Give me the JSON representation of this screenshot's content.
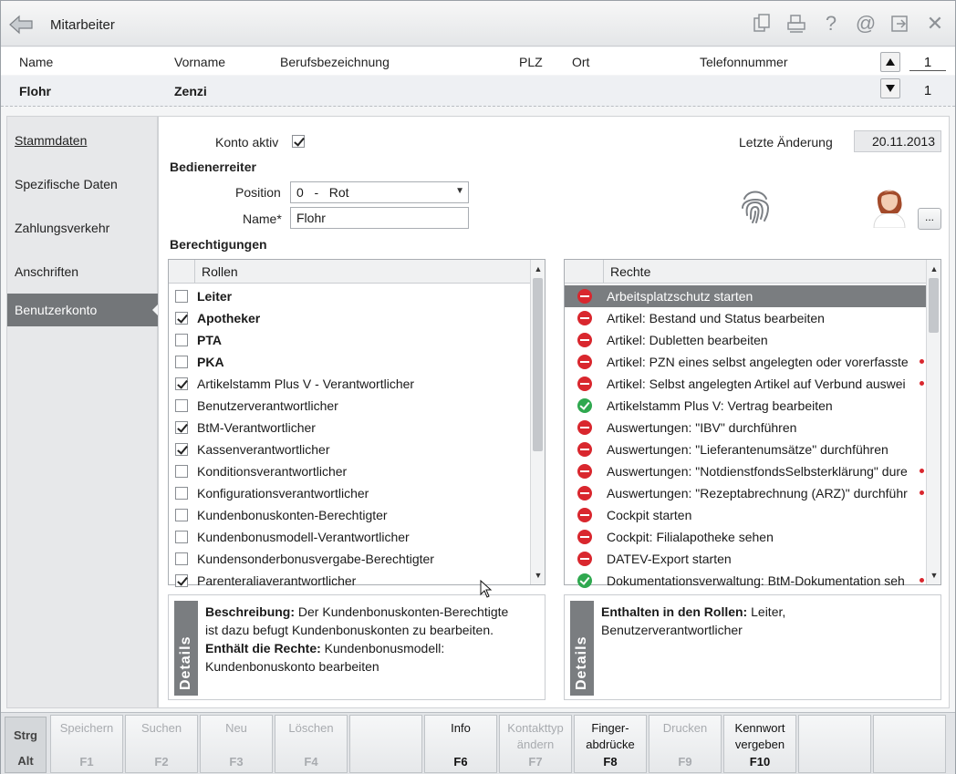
{
  "titlebar": {
    "title": "Mitarbeiter",
    "icons": [
      "back-icon",
      "copy-icon",
      "print-icon",
      "help-icon",
      "at-icon",
      "exit-icon",
      "close-icon"
    ]
  },
  "header": {
    "columns": {
      "name": "Name",
      "vorname": "Vorname",
      "beruf": "Berufsbezeichnung",
      "plz": "PLZ",
      "ort": "Ort",
      "telefon": "Telefonnummer"
    },
    "record": {
      "name": "Flohr",
      "vorname": "Zenzi"
    },
    "counter_top": "1",
    "counter_bottom": "1"
  },
  "nav": {
    "items": [
      {
        "label": "Stammdaten"
      },
      {
        "label": "Spezifische Daten"
      },
      {
        "label": "Zahlungsverkehr"
      },
      {
        "label": "Anschriften"
      },
      {
        "label": "Benutzerkonto"
      }
    ],
    "active_index": 4
  },
  "form": {
    "konto_aktiv_label": "Konto aktiv",
    "konto_aktiv": true,
    "letzte_aenderung_label": "Letzte Änderung",
    "letzte_aenderung": "20.11.2013",
    "bedienerreiter_label": "Bedienerreiter",
    "position_label": "Position",
    "position_value": "0   -   Rot",
    "name_label": "Name*",
    "name_value": "Flohr",
    "berechtigungen_label": "Berechtigungen",
    "dots_label": "..."
  },
  "roles": {
    "header": "Rollen",
    "items": [
      {
        "label": "Leiter",
        "checked": false,
        "bold": true
      },
      {
        "label": "Apotheker",
        "checked": true,
        "bold": true
      },
      {
        "label": "PTA",
        "checked": false,
        "bold": true
      },
      {
        "label": "PKA",
        "checked": false,
        "bold": true
      },
      {
        "label": "Artikelstamm Plus V - Verantwortlicher",
        "checked": true,
        "bold": false
      },
      {
        "label": "Benutzerverantwortlicher",
        "checked": false,
        "bold": false
      },
      {
        "label": "BtM-Verantwortlicher",
        "checked": true,
        "bold": false
      },
      {
        "label": "Kassenverantwortlicher",
        "checked": true,
        "bold": false
      },
      {
        "label": "Konditionsverantwortlicher",
        "checked": false,
        "bold": false
      },
      {
        "label": "Konfigurationsverantwortlicher",
        "checked": false,
        "bold": false
      },
      {
        "label": "Kundenbonuskonten-Berechtigter",
        "checked": false,
        "bold": false
      },
      {
        "label": "Kundenbonusmodell-Verantwortlicher",
        "checked": false,
        "bold": false
      },
      {
        "label": "Kundensonderbonusvergabe-Berechtigter",
        "checked": false,
        "bold": false
      },
      {
        "label": "Parenteraliaverantwortlicher",
        "checked": true,
        "bold": false
      }
    ]
  },
  "rights": {
    "header": "Rechte",
    "items": [
      {
        "label": "Arbeitsplatzschutz starten",
        "status": "deny",
        "selected": true
      },
      {
        "label": "Artikel: Bestand und Status bearbeiten",
        "status": "deny"
      },
      {
        "label": "Artikel: Dubletten bearbeiten",
        "status": "deny"
      },
      {
        "label": "Artikel: PZN eines selbst angelegten oder vorerfasste",
        "status": "deny",
        "truncated": true
      },
      {
        "label": "Artikel: Selbst angelegten Artikel auf Verbund auswei",
        "status": "deny",
        "truncated": true
      },
      {
        "label": "Artikelstamm Plus V: Vertrag bearbeiten",
        "status": "ok"
      },
      {
        "label": "Auswertungen: \"IBV\" durchführen",
        "status": "deny"
      },
      {
        "label": "Auswertungen: \"Lieferantenumsätze\" durchführen",
        "status": "deny"
      },
      {
        "label": "Auswertungen: \"NotdienstfondsSelbsterklärung\" dure",
        "status": "deny",
        "truncated": true
      },
      {
        "label": "Auswertungen: \"Rezeptabrechnung (ARZ)\" durchführ",
        "status": "deny",
        "truncated": true
      },
      {
        "label": "Cockpit starten",
        "status": "deny"
      },
      {
        "label": "Cockpit: Filialapotheke sehen",
        "status": "deny"
      },
      {
        "label": "DATEV-Export starten",
        "status": "deny"
      },
      {
        "label": "Dokumentationsverwaltung: BtM-Dokumentation seh",
        "status": "ok",
        "truncated": true
      }
    ]
  },
  "details_left": {
    "tab": "Details",
    "beschreibung_label": "Beschreibung:",
    "beschreibung_text_1": " Der Kundenbonuskonten-Berechtigte",
    "beschreibung_text_2": "ist dazu befugt Kundenbonuskonten zu bearbeiten.",
    "rechte_label": "Enthält die Rechte:",
    "rechte_text_1": " Kundenbonusmodell:",
    "rechte_text_2": "Kundenbonuskonto bearbeiten"
  },
  "details_right": {
    "tab": "Details",
    "rollen_label": "Enthalten in den Rollen:",
    "rollen_text_1": " Leiter,",
    "rollen_text_2": "Benutzerverantwortlicher"
  },
  "fkeys": {
    "mod_strg": "Strg",
    "mod_alt": "Alt",
    "keys": [
      {
        "label": "Speichern",
        "key": "F1",
        "enabled": false
      },
      {
        "label": "Suchen",
        "key": "F2",
        "enabled": false
      },
      {
        "label": "Neu",
        "key": "F3",
        "enabled": false
      },
      {
        "label": "Löschen",
        "key": "F4",
        "enabled": false
      },
      {
        "label": "",
        "key": "",
        "enabled": false
      },
      {
        "label": "Info",
        "key": "F6",
        "enabled": true
      },
      {
        "label": "Kontakttyp\nändern",
        "key": "F7",
        "enabled": false
      },
      {
        "label": "Finger-\nabdrücke",
        "key": "F8",
        "enabled": true
      },
      {
        "label": "Drucken",
        "key": "F9",
        "enabled": false
      },
      {
        "label": "Kennwort\nvergeben",
        "key": "F10",
        "enabled": true
      },
      {
        "label": "",
        "key": "",
        "enabled": false
      },
      {
        "label": "",
        "key": "",
        "enabled": false
      }
    ]
  },
  "colors": {
    "deny": "#d9272e",
    "ok": "#2fa84f",
    "selected_row": "#7a7d80",
    "active_nav": "#737679"
  }
}
